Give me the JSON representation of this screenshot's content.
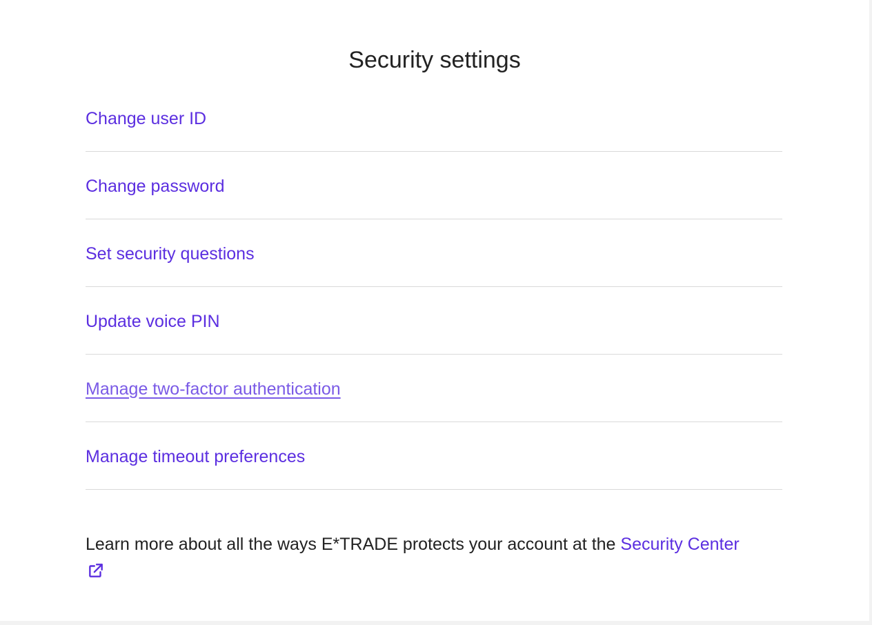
{
  "page": {
    "title": "Security settings"
  },
  "settings_links": [
    {
      "label": "Change user ID"
    },
    {
      "label": "Change password"
    },
    {
      "label": "Set security questions"
    },
    {
      "label": "Update voice PIN"
    },
    {
      "label": "Manage two-factor authentication"
    },
    {
      "label": "Manage timeout preferences"
    }
  ],
  "footer": {
    "text": "Learn more about all the ways E*TRADE protects your account at the ",
    "link_label": "Security Center",
    "link_icon": "external-link-icon"
  },
  "colors": {
    "link": "#5b2ee0",
    "link_hover": "#7a5ae6",
    "text": "#222222",
    "divider": "#d9d9d9"
  }
}
